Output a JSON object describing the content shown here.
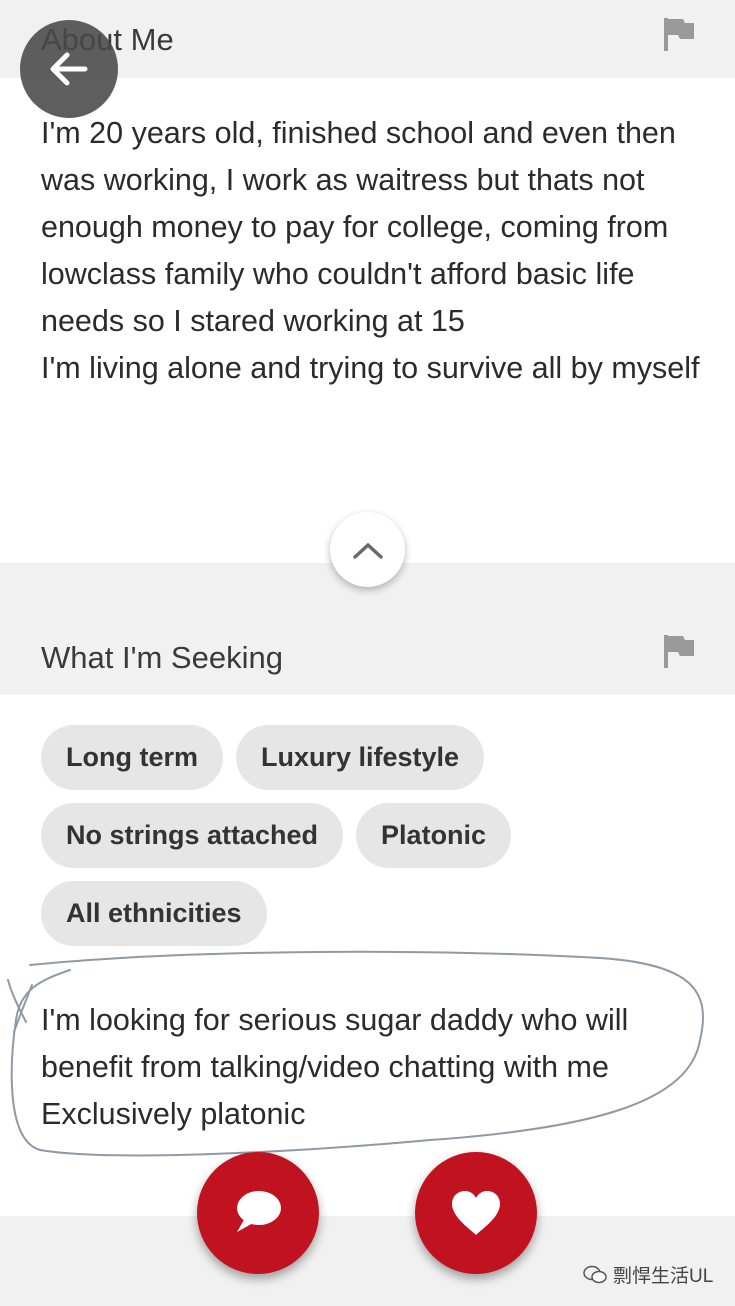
{
  "about": {
    "title": "About Me",
    "paragraph_1": "I'm 20 years old, finished school and even then was working, I work as waitress but thats not enough money to pay for college, coming from lowclass family who couldn't afford basic life needs so I stared working at 15",
    "paragraph_2": "I'm living alone and trying to survive all by myself"
  },
  "seeking": {
    "title": "What I'm Seeking",
    "tags": [
      "Long term",
      "Luxury lifestyle",
      "No strings attached",
      "Platonic",
      "All ethnicities"
    ],
    "note_lines": [
      "I'm looking for serious sugar daddy who will",
      "benefit from talking/video chatting with me",
      "Exclusively platonic"
    ]
  },
  "icons": {
    "back": "arrow-left-icon",
    "flag": "flag-icon",
    "collapse": "chevron-up-icon",
    "message": "chat-bubble-icon",
    "favorite": "heart-icon",
    "watermark": "wechat-icon"
  },
  "colors": {
    "accent": "#c1121f",
    "band": "#f1f1f1",
    "tag": "#e6e6e6"
  },
  "watermark": {
    "text": "剽悍生活UL"
  }
}
